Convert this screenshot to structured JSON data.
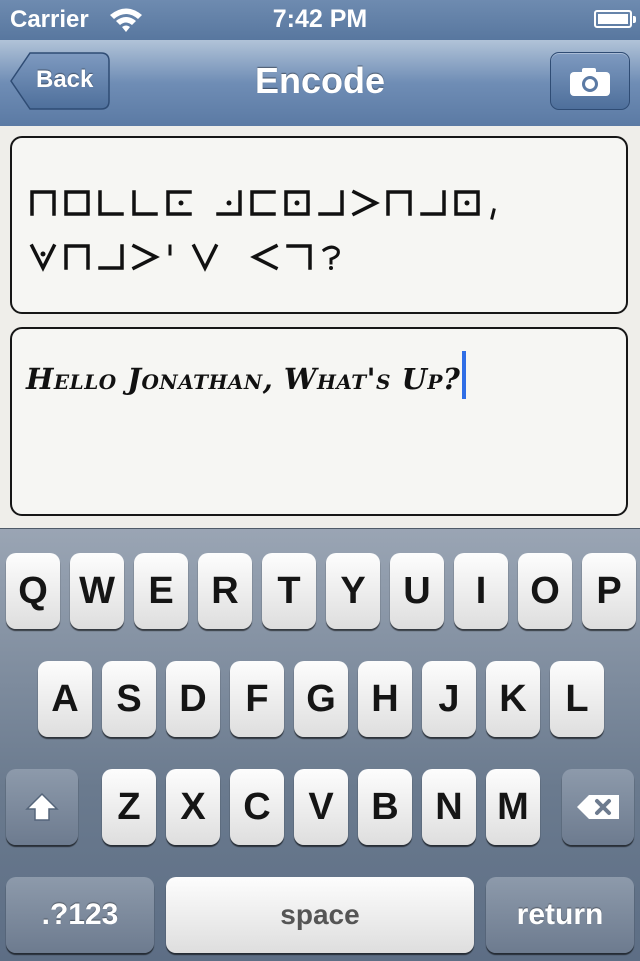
{
  "status_bar": {
    "carrier": "Carrier",
    "time": "7:42 PM"
  },
  "nav": {
    "back_label": "Back",
    "title": "Encode",
    "camera_icon": "camera-icon"
  },
  "cipher": {
    "line1": "Hello Jonathan,",
    "line2": "What's Up?",
    "font": "pigpen"
  },
  "input": {
    "value": "Hello Jonathan, What's Up?"
  },
  "keyboard": {
    "row1": [
      "Q",
      "W",
      "E",
      "R",
      "T",
      "Y",
      "U",
      "I",
      "O",
      "P"
    ],
    "row2": [
      "A",
      "S",
      "D",
      "F",
      "G",
      "H",
      "J",
      "K",
      "L"
    ],
    "row3": [
      "Z",
      "X",
      "C",
      "V",
      "B",
      "N",
      "M"
    ],
    "numbers_label": ".?123",
    "space_label": "space",
    "return_label": "return"
  },
  "colors": {
    "caret": "#2f6ee6",
    "nav_bar": "#6f8db5"
  }
}
